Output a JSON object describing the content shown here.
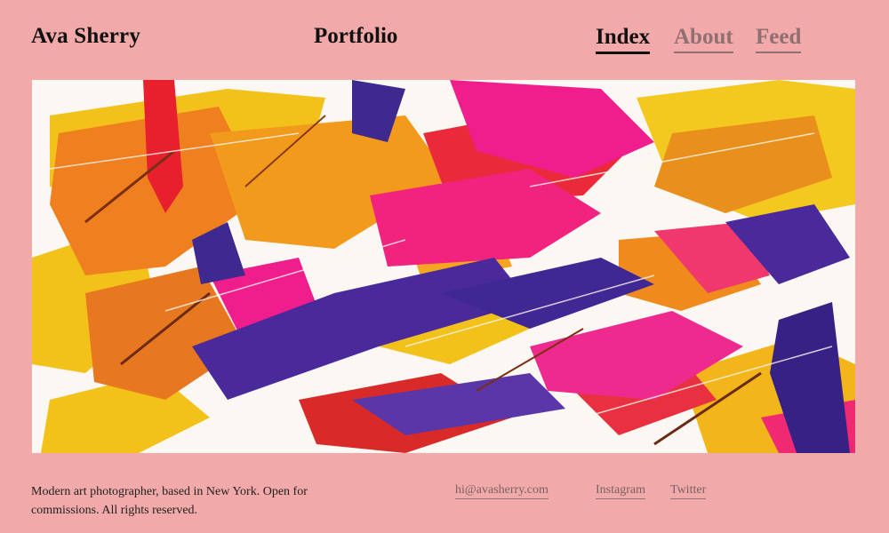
{
  "header": {
    "brand": "Ava Sherry",
    "title": "Portfolio",
    "nav": [
      {
        "label": "Index",
        "active": true
      },
      {
        "label": "About",
        "active": false
      },
      {
        "label": "Feed",
        "active": false
      }
    ]
  },
  "hero": {
    "palette": {
      "background": "#fbf7f2",
      "yellow": "#f2c21a",
      "orange": "#f08a1c",
      "red": "#ea2a3a",
      "magenta": "#f01e8c",
      "purple": "#4a2a9a",
      "brown": "#8a3a1c"
    }
  },
  "footer": {
    "description": "Modern art photographer, based in New York. Open for commissions. All rights reserved.",
    "email": "hi@avasherry.com",
    "social": {
      "instagram": "Instagram",
      "twitter": "Twitter"
    }
  },
  "colors": {
    "page_background": "#f2a9a9",
    "text": "#111111",
    "muted_link": "#8f6f72"
  }
}
